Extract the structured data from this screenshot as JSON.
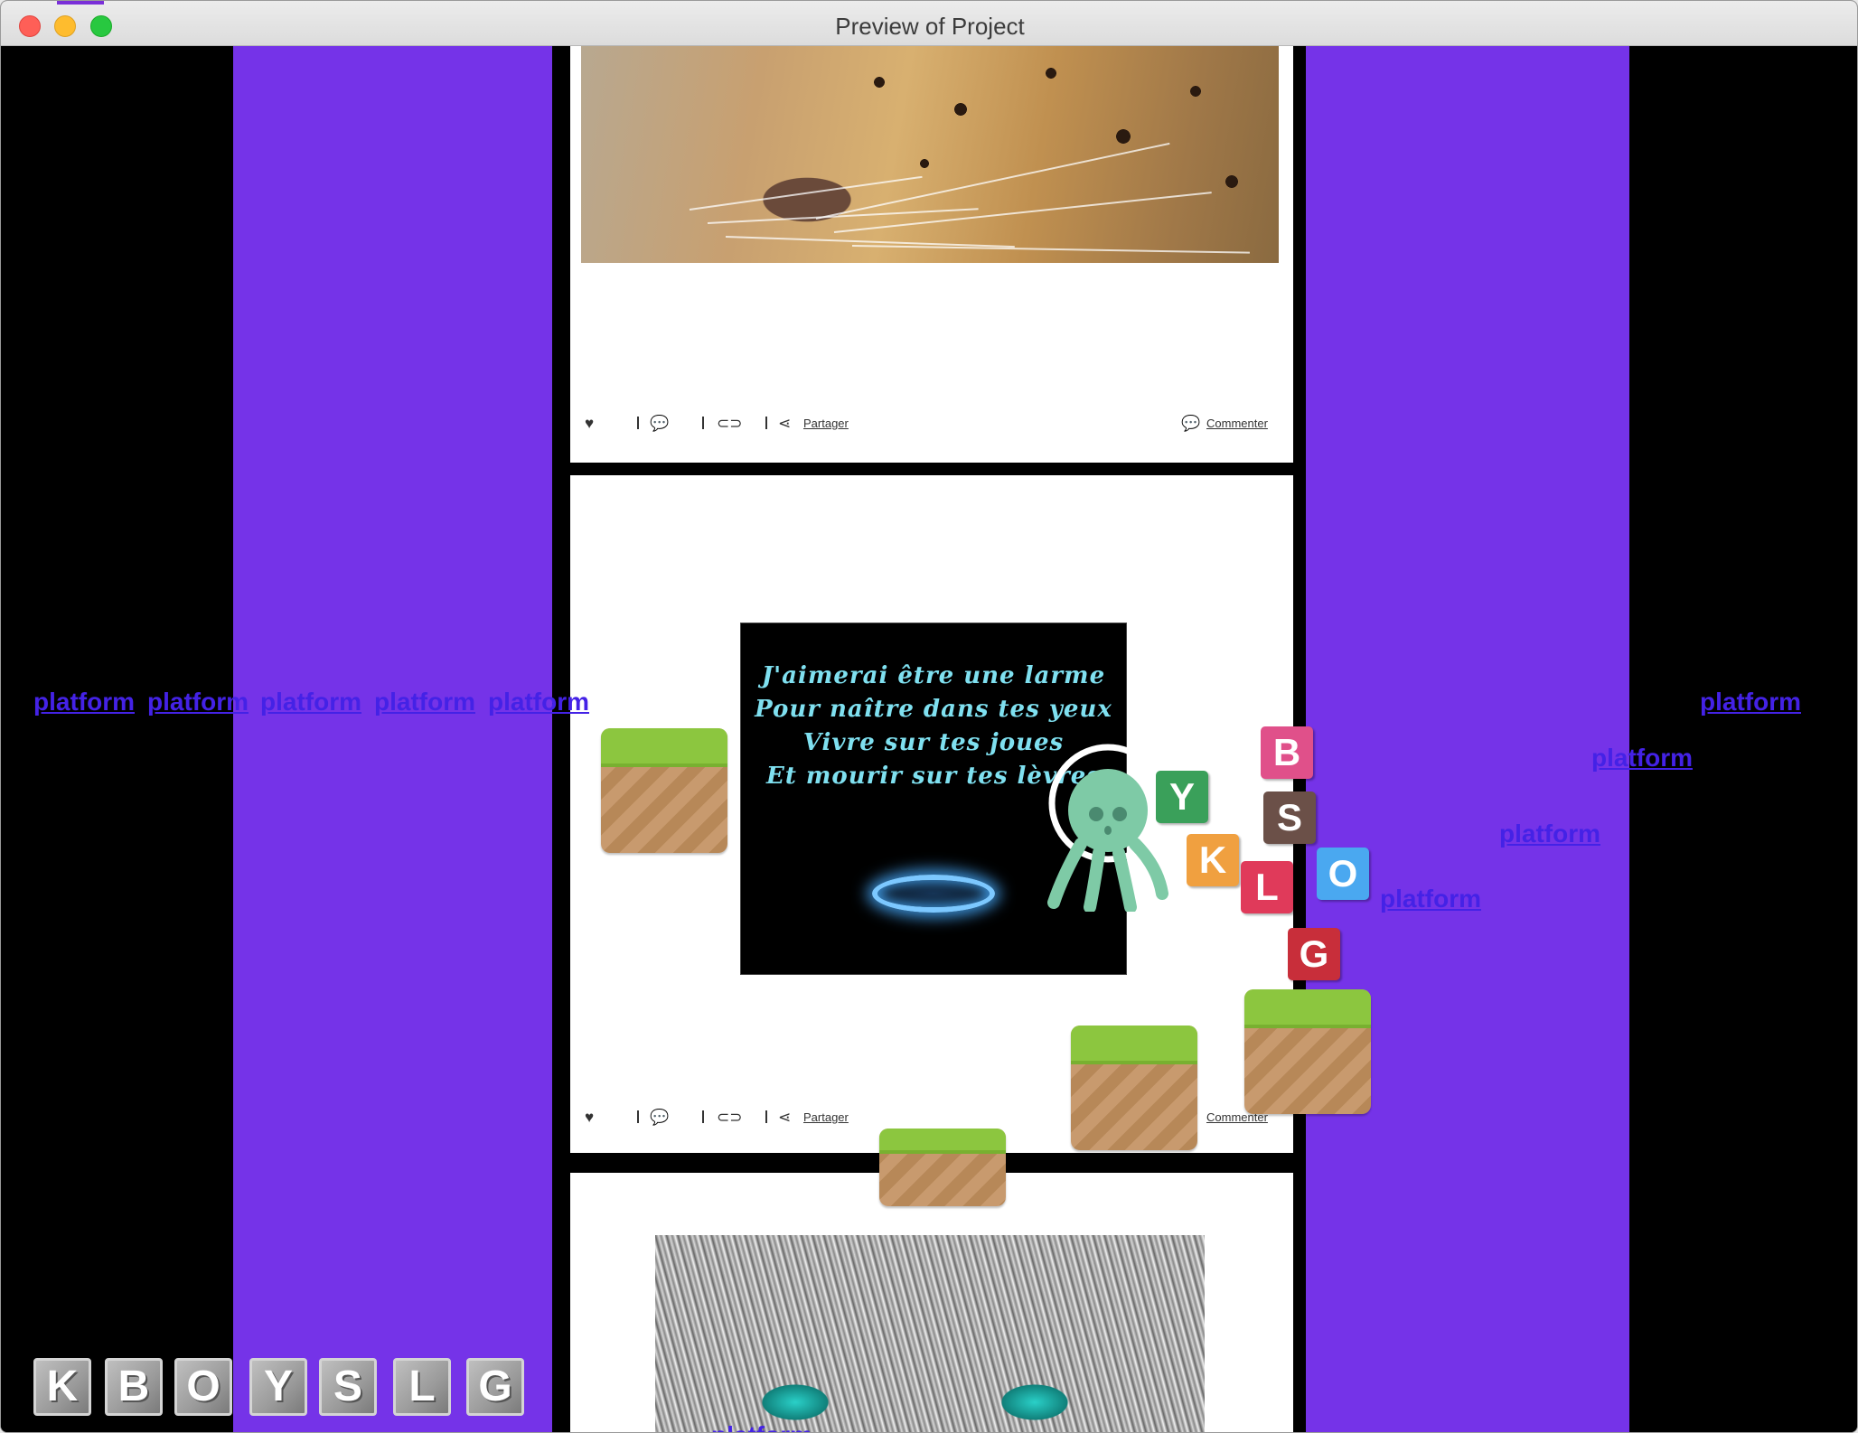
{
  "window": {
    "title": "Preview of Project"
  },
  "posts": {
    "like_icon": "heart-icon",
    "share_label": "Partager",
    "comment_label": "Commenter"
  },
  "poem": {
    "line1": "J'aimerai être une larme",
    "line2": "Pour naître dans tes yeux",
    "line3": "Vivre sur tes joues",
    "line4": "Et mourir sur tes lèvres"
  },
  "platform_labels": {
    "l1": "platform",
    "l2": "platform",
    "l3": "platform",
    "l4": "platform",
    "l5": "platform",
    "r1": "platform",
    "r2": "platform",
    "r3": "platform",
    "r4": "platform",
    "b1": "platform"
  },
  "letter_tiles": {
    "b": "B",
    "s": "S",
    "y": "Y",
    "k": "K",
    "l": "L",
    "o": "O",
    "g": "G"
  },
  "hud_tiles": {
    "k": "K",
    "b": "B",
    "o": "O",
    "y": "Y",
    "s": "S",
    "l": "L",
    "g": "G"
  },
  "colors": {
    "purple_band": "#7533e8",
    "link_blue": "#4422e6",
    "ground_grass": "#8cc63f",
    "ground_dirt": "#c89a6e"
  }
}
